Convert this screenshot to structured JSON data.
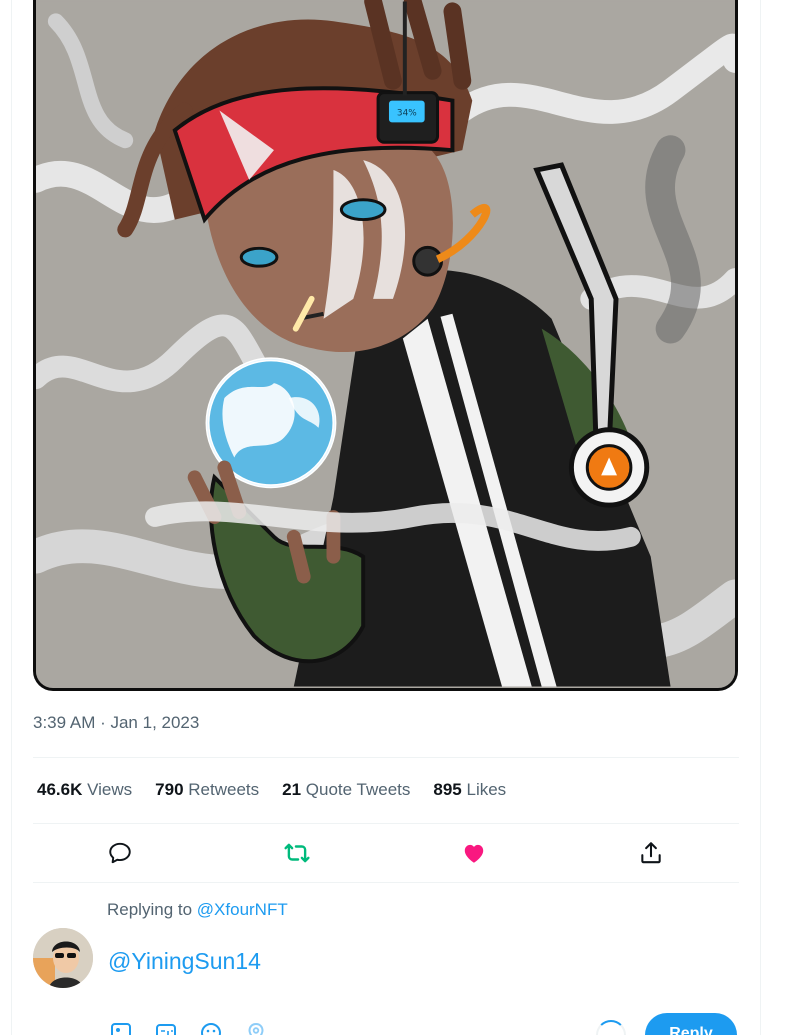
{
  "tweet": {
    "timestamp": "3:39 AM · Jan 1, 2023",
    "stats": [
      {
        "value": "46.6K",
        "label": "Views"
      },
      {
        "value": "790",
        "label": "Retweets"
      },
      {
        "value": "21",
        "label": "Quote Tweets"
      },
      {
        "value": "895",
        "label": "Likes"
      }
    ],
    "actions": {
      "reply_icon": "comment-icon",
      "retweet_icon": "retweet-icon",
      "like_icon": "heart-icon",
      "share_icon": "share-icon"
    },
    "colors": {
      "retweet_active": "#00ba7c",
      "like_active": "#f91880",
      "accent": "#1d9bf0"
    },
    "artwork": {
      "battery_text": "34%"
    }
  },
  "reply": {
    "replying_prefix": "Replying to",
    "replying_handle": "@XfourNFT",
    "composer_text": "@YiningSun14",
    "tools": [
      "image-icon",
      "gif-icon",
      "emoji-icon",
      "location-icon"
    ],
    "button_label": "Reply"
  }
}
